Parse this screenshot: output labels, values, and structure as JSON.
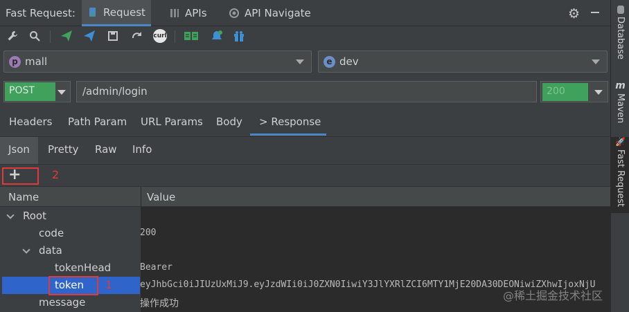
{
  "title_bar": {
    "app_label": "Fast Request:",
    "tabs": [
      {
        "label": "Request",
        "icon": "request-icon"
      },
      {
        "label": "APIs",
        "icon": "apis-icon"
      },
      {
        "label": "API Navigate",
        "icon": "navigate-icon"
      }
    ],
    "active_tab": "Request"
  },
  "toolbar": {
    "icons": [
      "wrench-icon",
      "search-icon",
      "send-icon",
      "send-debug-icon",
      "save-icon",
      "redo-icon",
      "curl-icon",
      "book-icon",
      "bell-icon",
      "gift-icon"
    ],
    "curl_label": "curl"
  },
  "project": {
    "badge": "p",
    "value": "mall"
  },
  "environment": {
    "badge": "e",
    "value": "dev"
  },
  "method": {
    "value": "POST"
  },
  "url": {
    "value": "/admin/login"
  },
  "status": {
    "value": "200"
  },
  "request_tabs": [
    "Headers",
    "Path Param",
    "URL Params",
    "Body",
    "> Response"
  ],
  "response_tabs": [
    "Json",
    "Pretty",
    "Raw",
    "Info"
  ],
  "annotations": {
    "two": "2",
    "one": "1"
  },
  "table": {
    "headers": {
      "name": "Name",
      "value": "Value"
    },
    "rows": [
      {
        "name": "Root",
        "value": ""
      },
      {
        "name": "code",
        "value": "200"
      },
      {
        "name": "data",
        "value": ""
      },
      {
        "name": "tokenHead",
        "value": "Bearer"
      },
      {
        "name": "token",
        "value": "eyJhbGci0iJIUzUxMiJ9.eyJzdWIi0iJ0ZXN0IiwiY3JlYXRlZCI6MTY1MjE20DA30DEONiwiZXhwIjoxNjU"
      },
      {
        "name": "message",
        "value": "操作成功"
      }
    ]
  },
  "side_strip": [
    "Database",
    "Maven",
    "Fast Request"
  ],
  "watermark": "@稀土掘金技术社区",
  "colors": {
    "accent": "#4a88c7",
    "method_green": "#3fa15b",
    "selection": "#2f65ca",
    "annotation_red": "#e03a3a"
  }
}
